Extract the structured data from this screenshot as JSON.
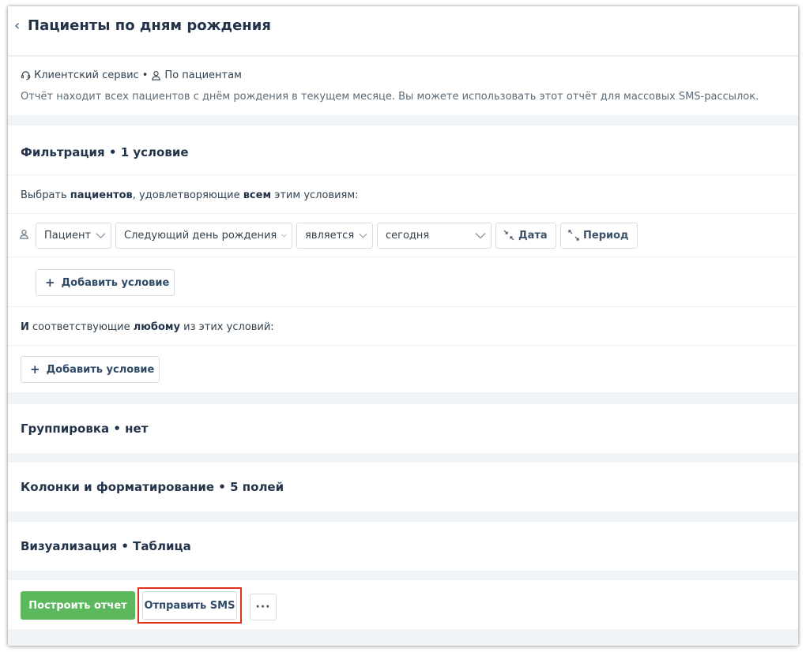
{
  "header": {
    "back_icon": "‹",
    "title": "Пациенты по дням рождения"
  },
  "info": {
    "service_icon": "headset-icon",
    "service": "Клиентский сервис",
    "separator": "•",
    "by_icon": "person-icon",
    "by": "По пациентам",
    "description": "Отчёт находит всех пациентов с днём рождения в текущем месяце. Вы можете использовать этот отчёт для массовых SMS-рассылок."
  },
  "filter": {
    "title": "Фильтрация • 1 условие",
    "select_prefix": "Выбрать ",
    "select_entity": "пациентов",
    "select_middle": ", удовлетворяющие ",
    "select_all": "всем",
    "select_suffix": " этим условиям:",
    "condition": {
      "field_group": "Пациент",
      "field": "Следующий день рождения",
      "operator": "является",
      "value": "сегодня",
      "date_button": "Дата",
      "period_button": "Период"
    },
    "add_condition_label": "Добавить условие",
    "or_prefix": "И",
    "or_middle": " соответствующие ",
    "or_any": "любому",
    "or_suffix": " из этих условий:",
    "add_condition_label_2": "Добавить условие"
  },
  "grouping": {
    "title": "Группировка • нет"
  },
  "columns": {
    "title": "Колонки и форматирование • 5 полей"
  },
  "visualization": {
    "title": "Визуализация • Таблица"
  },
  "footer": {
    "build_label": "Построить отчет",
    "sms_label": "Отправить SMS",
    "more_label": "···"
  },
  "colors": {
    "primary_green": "#5cb85c",
    "highlight_red": "#e0301e",
    "title_navy": "#22334a"
  }
}
